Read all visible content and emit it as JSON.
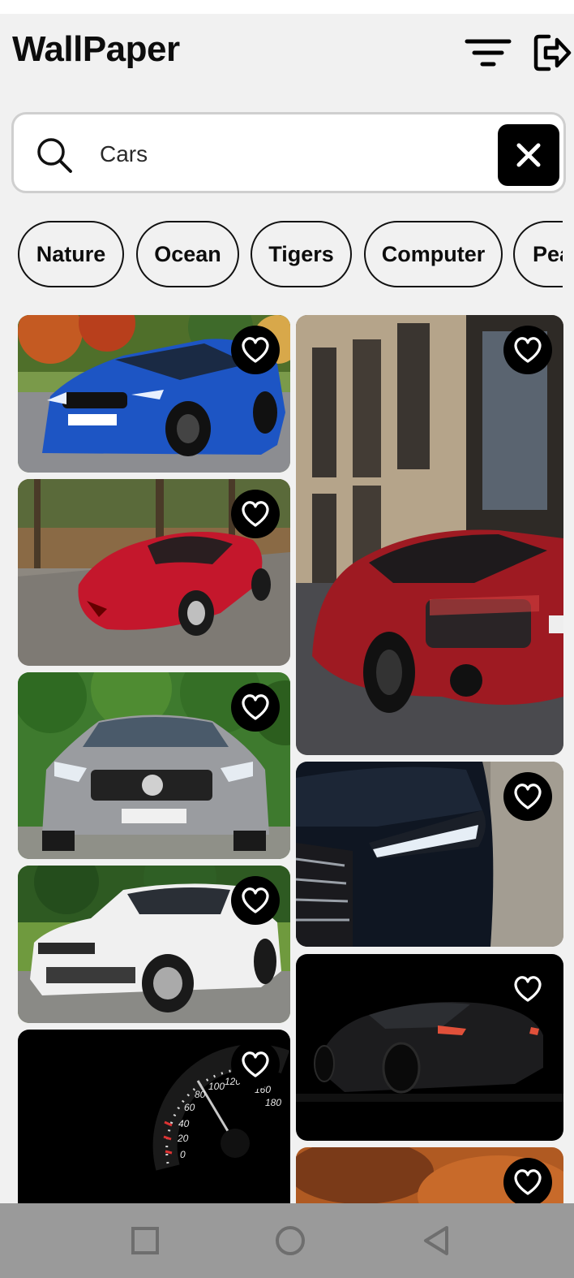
{
  "header": {
    "title": "WallPaper",
    "filter_icon": "filter-lines-icon",
    "logout_icon": "logout-icon"
  },
  "search": {
    "value": "Cars",
    "placeholder": "",
    "search_icon": "search-icon",
    "clear_icon": "close-icon"
  },
  "categories": [
    "Nature",
    "Ocean",
    "Tigers",
    "Computer",
    "Pea"
  ],
  "wallpapers": [
    {
      "subject": "blue BMW",
      "favorite_icon": "heart-outline-icon"
    },
    {
      "subject": "red sports car on road",
      "favorite_icon": "heart-outline-icon"
    },
    {
      "subject": "silver Mercedes AMG",
      "favorite_icon": "heart-outline-icon"
    },
    {
      "subject": "white Range Rover",
      "favorite_icon": "heart-outline-icon"
    },
    {
      "subject": "speedometer",
      "favorite_icon": "heart-outline-icon"
    },
    {
      "subject": "red Audi R8 on street",
      "favorite_icon": "heart-outline-icon"
    },
    {
      "subject": "dark Audi headlight",
      "favorite_icon": "heart-outline-icon"
    },
    {
      "subject": "black car in darkness",
      "favorite_icon": "heart-outline-icon"
    },
    {
      "subject": "blurred orange",
      "favorite_icon": "heart-outline-icon"
    }
  ],
  "speedometer_labels": [
    "0",
    "20",
    "40",
    "60",
    "80",
    "100",
    "120",
    "160",
    "180"
  ],
  "navbar": {
    "icons": [
      "square-recents-icon",
      "circle-home-icon",
      "triangle-back-icon"
    ]
  },
  "colors": {
    "background": "#f1f1f1",
    "accent": "#000000",
    "navbar": "#9a9a9a"
  }
}
